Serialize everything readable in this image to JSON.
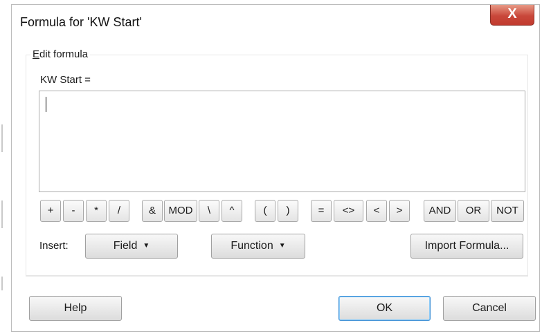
{
  "window": {
    "title": "Formula for 'KW Start'",
    "close_label": "X"
  },
  "group": {
    "label_underlined": "E",
    "label_rest": "dit formula"
  },
  "formula": {
    "field_label": "KW Start =",
    "value": ""
  },
  "operators": [
    "+",
    "-",
    "*",
    "/",
    "&",
    "MOD",
    "\\",
    "^",
    "(",
    ")",
    "=",
    "<>",
    "<",
    ">",
    "AND",
    "OR",
    "NOT"
  ],
  "insert": {
    "label": "Insert:",
    "field_button": "Field",
    "function_button": "Function",
    "import_button": "Import Formula..."
  },
  "footer": {
    "help": "Help",
    "ok": "OK",
    "cancel": "Cancel"
  }
}
